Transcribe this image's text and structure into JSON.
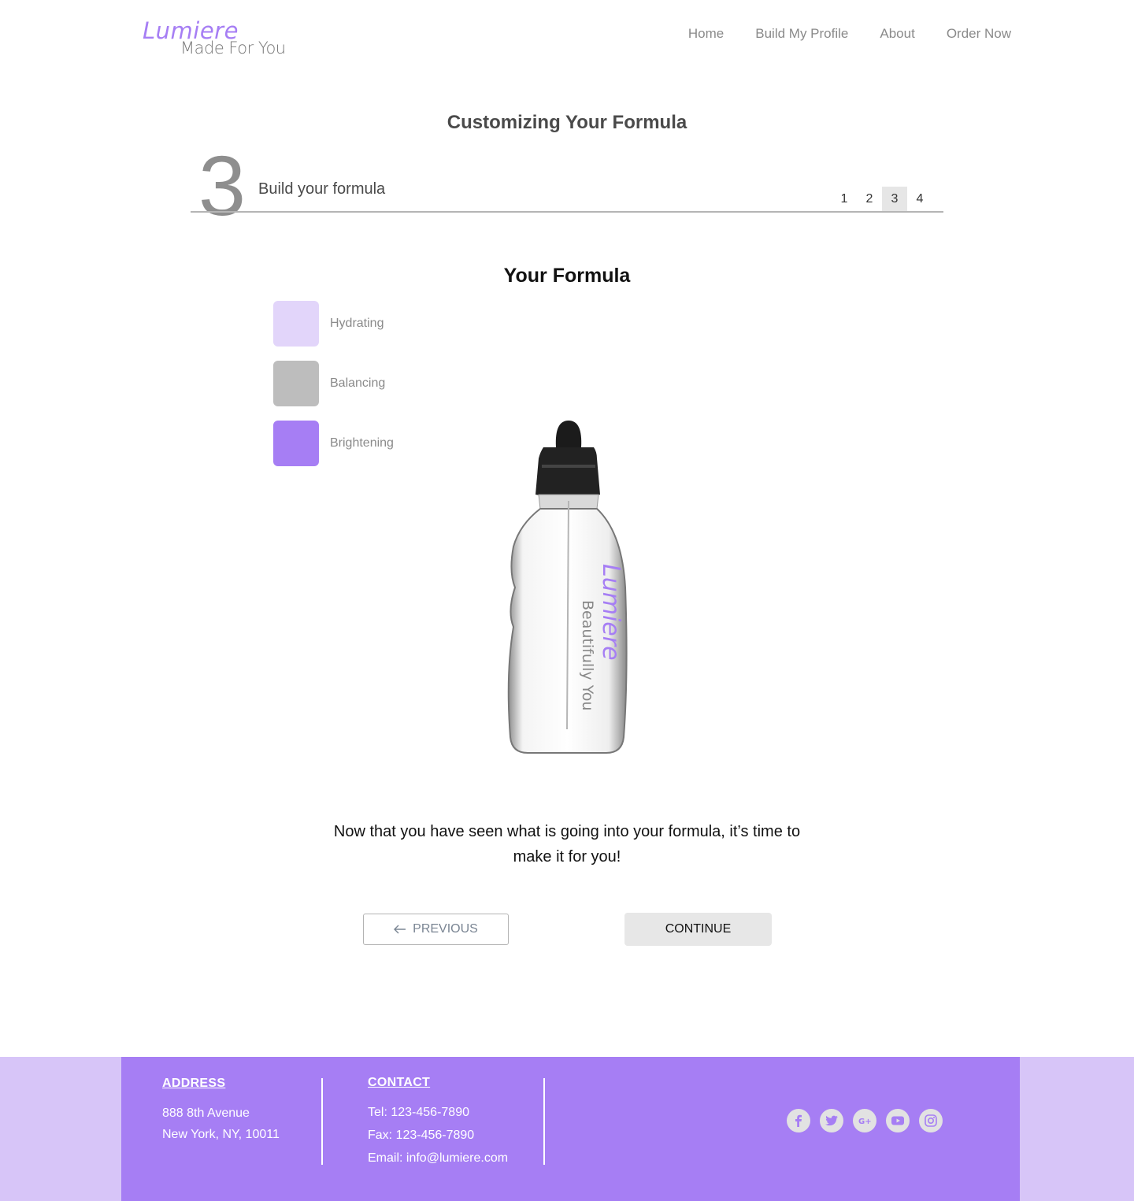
{
  "brand": {
    "name": "Lumiere",
    "tagline": "Made For You"
  },
  "nav": {
    "items": [
      "Home",
      "Build My Profile",
      "About",
      "Order Now"
    ]
  },
  "page": {
    "title": "Customizing Your Formula"
  },
  "step": {
    "number": "3",
    "label": "Build your formula",
    "pages": [
      "1",
      "2",
      "3",
      "4"
    ],
    "active_page": "3"
  },
  "formula": {
    "title": "Your Formula",
    "ingredients": [
      {
        "label": "Hydrating",
        "color": "#e2d5fa"
      },
      {
        "label": "Balancing",
        "color": "#bdbdbd"
      },
      {
        "label": "Brightening",
        "color": "#a67ef4"
      }
    ]
  },
  "bottle": {
    "brand": "Lumiere",
    "tagline": "Beautifully You"
  },
  "message": "Now that you have seen what is going into your formula, it’s time to make it for you!",
  "buttons": {
    "previous": "PREVIOUS",
    "continue": "CONTINUE"
  },
  "footer": {
    "address_title": "ADDRESS",
    "address_line1": "888 8th Avenue",
    "address_line2": "New York, NY, 10011",
    "contact_title": "CONTACT",
    "tel": "Tel: 123-456-7890",
    "fax": "Fax: 123-456-7890",
    "email": "Email: info@lumiere.com",
    "social": [
      "facebook-icon",
      "twitter-icon",
      "google-plus-icon",
      "youtube-icon",
      "instagram-icon"
    ]
  },
  "colors": {
    "accent": "#a67ef4",
    "accent_light": "#d7c5f8"
  }
}
